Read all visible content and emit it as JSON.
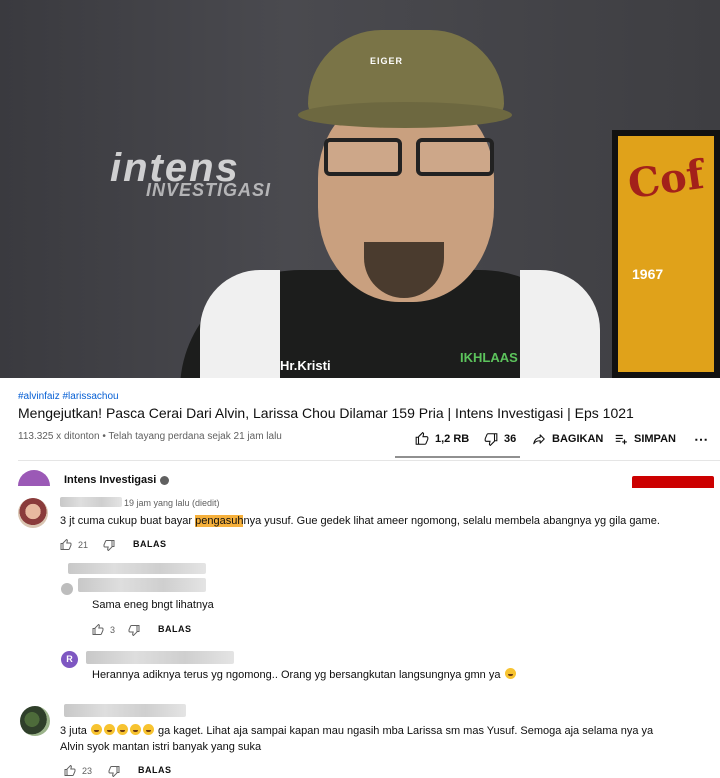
{
  "video": {
    "watermark": "intens",
    "watermark_sub": "INVESTIGASI",
    "cap_logo": "EIGER",
    "poster_text": "Cof",
    "poster_year": "1967",
    "shirt_text": "Hr.Kristi",
    "shirt_text2": "IKHLAAS"
  },
  "meta": {
    "hashtags": "#alvinfaiz #larissachou",
    "title": "Mengejutkan! Pasca Cerai Dari Alvin, Larissa Chou Dilamar 159 Pria | Intens Investigasi | Eps 1021",
    "views": "113.325 x ditonton • Telah tayang perdana sejak 21 jam lalu",
    "likes": "1,2 RB",
    "dislikes": "36",
    "share": "BAGIKAN",
    "save": "SIMPAN"
  },
  "channel": {
    "name": "Intens Investigasi"
  },
  "comments": [
    {
      "time": "19 jam yang lalu (diedit)",
      "text_before": "3 jt cuma cukup buat bayar ",
      "text_highlight": "pengasuh",
      "text_after": "nya yusuf. Gue gedek lihat ameer ngomong, selalu membela abangnya yg gila game.",
      "likes": "21",
      "reply_label": "BALAS"
    },
    {
      "text": "Sama eneg bngt lihatnya",
      "likes": "3",
      "reply_label": "BALAS"
    },
    {
      "avatar_letter": "R",
      "text": "Herannya adiknya terus yg ngomong.. Orang yg bersangkutan langsungnya gmn ya"
    },
    {
      "text_prefix": "3 juta",
      "text_rest": "ga kaget. Lihat aja sampai kapan mau ngasih mba Larissa sm mas Yusuf. Semoga aja selama nya ya",
      "text_line2": "Alvin syok mantan istri banyak yang suka",
      "likes": "23",
      "reply_label": "BALAS"
    }
  ],
  "colors": {
    "highlight": "#f6b03b",
    "link": "#065fd4",
    "subscribe": "#cc0000"
  }
}
